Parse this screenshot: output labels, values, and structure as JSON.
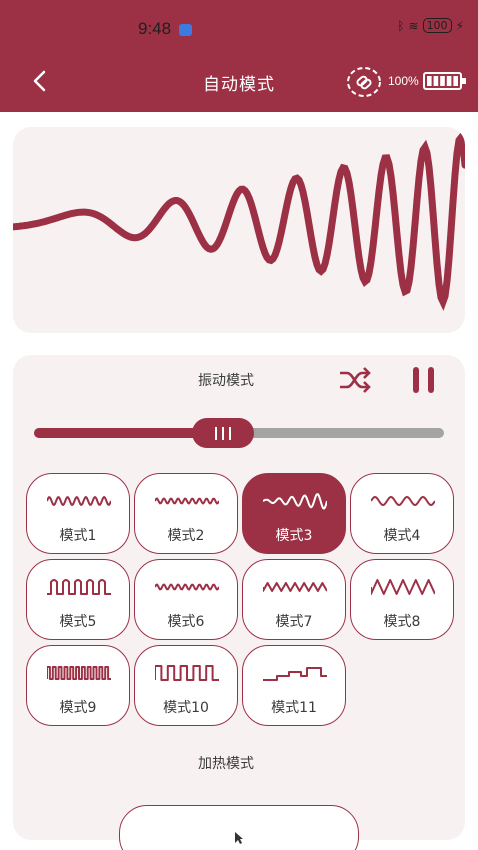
{
  "status_bar": {
    "time": "9:48",
    "battery": "100"
  },
  "header": {
    "title": "自动模式",
    "battery_percent": "100%",
    "battery_level": 1.0
  },
  "vibration": {
    "label": "振动模式",
    "slider_value": 0.46,
    "selected_mode": 3,
    "modes": [
      {
        "label": "模式1",
        "pattern": "wave-dense"
      },
      {
        "label": "模式2",
        "pattern": "wave-fine"
      },
      {
        "label": "模式3",
        "pattern": "wave-grow"
      },
      {
        "label": "模式4",
        "pattern": "wave-soft"
      },
      {
        "label": "模式5",
        "pattern": "pulse-round"
      },
      {
        "label": "模式6",
        "pattern": "wave-fine"
      },
      {
        "label": "模式7",
        "pattern": "zigzag-soft"
      },
      {
        "label": "模式8",
        "pattern": "zigzag"
      },
      {
        "label": "模式9",
        "pattern": "square-dense"
      },
      {
        "label": "模式10",
        "pattern": "square"
      },
      {
        "label": "模式11",
        "pattern": "steps"
      }
    ]
  },
  "heating": {
    "label": "加热模式"
  },
  "colors": {
    "brand": "#9c3146",
    "panel": "#f7f1f2",
    "track": "#a4a4a4"
  }
}
